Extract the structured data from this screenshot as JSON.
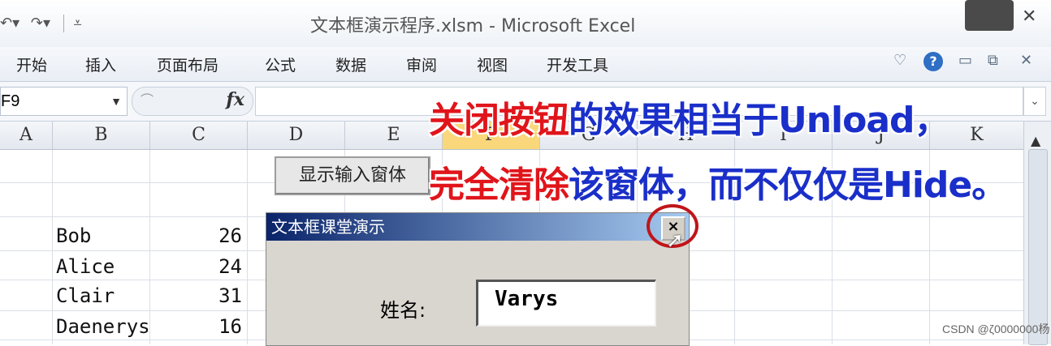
{
  "window": {
    "title": "文本框演示程序.xlsm - Microsoft Excel",
    "qat_icons": [
      "undo-icon",
      "redo-icon",
      "customize-qat-icon"
    ]
  },
  "ribbon": {
    "tabs": [
      "开始",
      "插入",
      "页面布局",
      "公式",
      "数据",
      "审阅",
      "视图",
      "开发工具"
    ]
  },
  "formula_bar": {
    "name_box": "F9",
    "fx_label": "fx",
    "formula": ""
  },
  "columns": [
    "A",
    "B",
    "C",
    "D",
    "E",
    "F",
    "G",
    "H",
    "I",
    "J",
    "K"
  ],
  "selected_column": "F",
  "rows": [
    {
      "name": "Bob",
      "value": "26"
    },
    {
      "name": "Alice",
      "value": "24"
    },
    {
      "name": "Clair",
      "value": "31"
    },
    {
      "name": "Daenerys",
      "value": "16"
    }
  ],
  "sheet_button": {
    "label": "显示输入窗体"
  },
  "userform": {
    "title": "文本框课堂演示",
    "close_label": "×",
    "name_label": "姓名:",
    "name_value": "Varys"
  },
  "annotation": {
    "line1_red": "关闭按钮",
    "line1_blue": "的效果相当于Unload，",
    "line2_red": "完全清除",
    "line2_blue": "该窗体，而不仅仅是Hide。"
  },
  "watermark": "CSDN @ζ0000000杨"
}
